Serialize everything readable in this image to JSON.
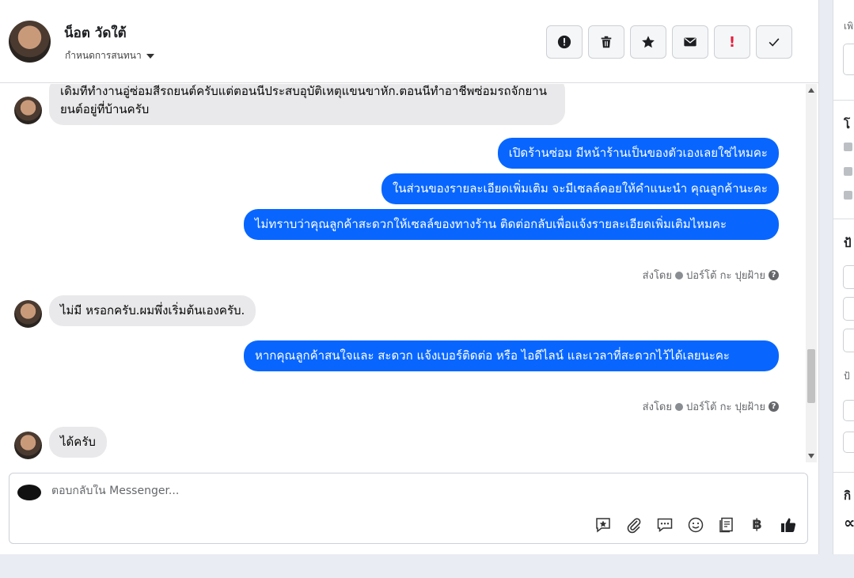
{
  "header": {
    "contact_name": "น็อต วัดใต้",
    "assign_label": "กำหนดการสนทนา"
  },
  "actions": {
    "icons": [
      "alert-circle-icon",
      "trash-icon",
      "star-icon",
      "envelope-icon",
      "exclamation-icon",
      "check-icon"
    ],
    "exclamation": "!"
  },
  "messages": {
    "m1": "เดิมทีทำงานอู่ซ่อมสีรถยนต์ครับแต่ตอนนีประสบอุบัติเหตุแขนขาหัก.ตอนนีทำอาชีพซ่อมรถจักยานยนต์อยู่ที่บ้านครับ",
    "m2": "เปิดร้านซ่อม มีหน้าร้านเป็นของตัวเองเลยใช่ไหมคะ",
    "m3": "ในส่วนของรายละเอียดเพิ่มเติม จะมีเซลล์คอยให้คำแนะนำ คุณลูกค้านะคะ",
    "m4": "ไม่ทราบว่าคุณลูกค้าสะดวกให้เซลล์ของทางร้าน ติดต่อกลับเพื่อแจ้งรายละเอียดเพิ่มเติมไหมคะ",
    "m5": "ไม่มี หรอกครับ.ผมพึ่งเริ่มต้นเองครับ.",
    "m6": "หากคุณลูกค้าสนใจและ สะดวก แจ้งเบอร์ติดต่อ หรือ ไอดีไลน์ และเวลาที่สะดวกไว้ได้เลยนะคะ",
    "m7": "ได้ครับ"
  },
  "sent_by": {
    "label": "ส่งโดย",
    "agent": "ปอร์โต้ กะ ปุยฝ้าย",
    "help": "?"
  },
  "composer": {
    "placeholder": "ตอบกลับใน Messenger...",
    "baht": "฿",
    "tools": [
      "sticker-star-icon",
      "attachment-icon",
      "saved-reply-icon",
      "emoji-icon",
      "catalog-icon",
      "baht-icon",
      "like-icon"
    ]
  },
  "right_panel": {
    "line1": "เพิ",
    "heading1": "โ",
    "heading2": "ป้",
    "line2": "ป้",
    "heading3": "กิ",
    "infinity": "∝"
  }
}
